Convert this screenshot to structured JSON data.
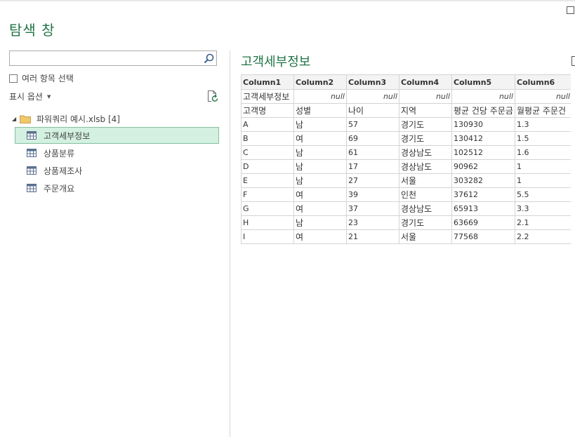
{
  "window": {
    "title": "탐색 창"
  },
  "left_pane": {
    "search": {
      "value": "",
      "placeholder": ""
    },
    "multi_select_label": "여러 항목 선택",
    "display_options_label": "표시 옵션",
    "tree": {
      "folder_label": "파워쿼리 예시.xlsb [4]",
      "items": [
        {
          "label": "고객세부정보",
          "selected": true
        },
        {
          "label": "상품분류",
          "selected": false
        },
        {
          "label": "상품제조사",
          "selected": false
        },
        {
          "label": "주문개요",
          "selected": false
        }
      ]
    }
  },
  "preview": {
    "title": "고객세부정보",
    "columns": [
      "Column1",
      "Column2",
      "Column3",
      "Column4",
      "Column5",
      "Column6"
    ],
    "rows": [
      [
        "고객세부정보",
        "null",
        "null",
        "null",
        "null",
        "null"
      ],
      [
        "고객명",
        "성별",
        "나이",
        "지역",
        "평균 건당 주문금",
        "월평균 주문건"
      ],
      [
        "A",
        "남",
        "57",
        "경기도",
        "130930",
        "1.3"
      ],
      [
        "B",
        "여",
        "69",
        "경기도",
        "130412",
        "1.5"
      ],
      [
        "C",
        "남",
        "61",
        "경상남도",
        "102512",
        "1.6"
      ],
      [
        "D",
        "남",
        "17",
        "경상남도",
        "90962",
        "1"
      ],
      [
        "E",
        "남",
        "27",
        "서울",
        "303282",
        "1"
      ],
      [
        "F",
        "여",
        "39",
        "인천",
        "37612",
        "5.5"
      ],
      [
        "G",
        "여",
        "37",
        "경상남도",
        "65913",
        "3.3"
      ],
      [
        "H",
        "남",
        "23",
        "경기도",
        "63669",
        "2.1"
      ],
      [
        "I",
        "여",
        "21",
        "서울",
        "77568",
        "2.2"
      ]
    ]
  },
  "colors": {
    "accent": "#217346",
    "selected_bg": "#d3f0e0",
    "selected_border": "#86bfa0"
  }
}
